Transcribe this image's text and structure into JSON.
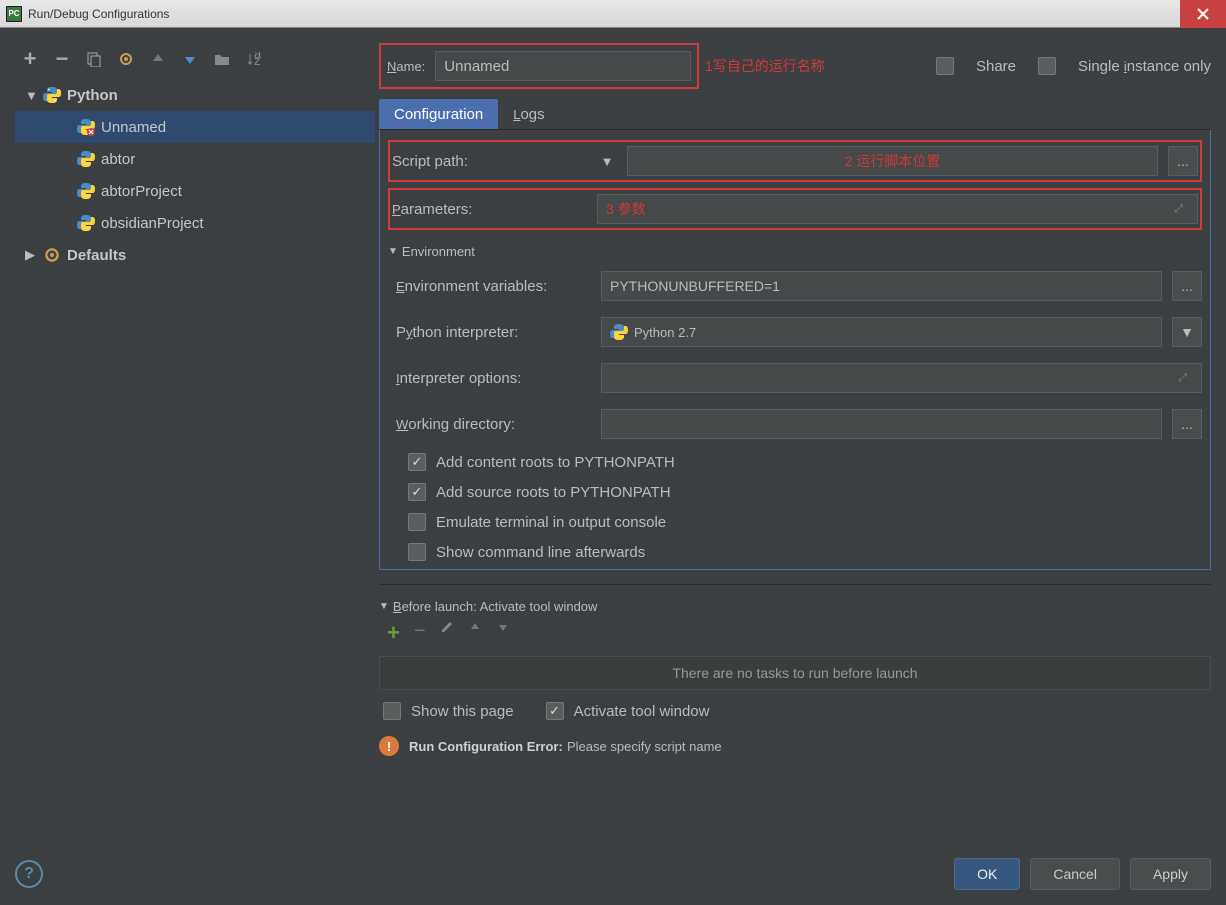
{
  "window_title": "Run/Debug Configurations",
  "header": {
    "name_label": "Name:",
    "name_value": "Unnamed",
    "annotation1": "1写自己的运行名称",
    "share_label": "Share",
    "single_label": "Single instance only"
  },
  "tree": {
    "python": "Python",
    "items": [
      "Unnamed",
      "abtor",
      "abtorProject",
      "obsidianProject"
    ],
    "defaults": "Defaults"
  },
  "tabs": {
    "config": "Configuration",
    "logs": "Logs"
  },
  "form": {
    "script_label": "Script path:",
    "script_ann": "2  运行脚本位置",
    "param_label": "Parameters:",
    "param_ann": "3 参数",
    "env_hdr": "Environment",
    "envvar_label": "Environment variables:",
    "envvar_value": "PYTHONUNBUFFERED=1",
    "interp_label": "Python interpreter:",
    "interp_value": "Python 2.7",
    "interpopt_label": "Interpreter options:",
    "workdir_label": "Working directory:",
    "chk1": "Add content roots to PYTHONPATH",
    "chk2": "Add source roots to PYTHONPATH",
    "chk3": "Emulate terminal in output console",
    "chk4": "Show command line afterwards"
  },
  "before": {
    "hdr": "Before launch: Activate tool window",
    "empty": "There are no tasks to run before launch",
    "show": "Show this page",
    "activate": "Activate tool window"
  },
  "error": {
    "title": "Run Configuration Error:",
    "msg": "Please specify script name"
  },
  "buttons": {
    "ok": "OK",
    "cancel": "Cancel",
    "apply": "Apply"
  }
}
